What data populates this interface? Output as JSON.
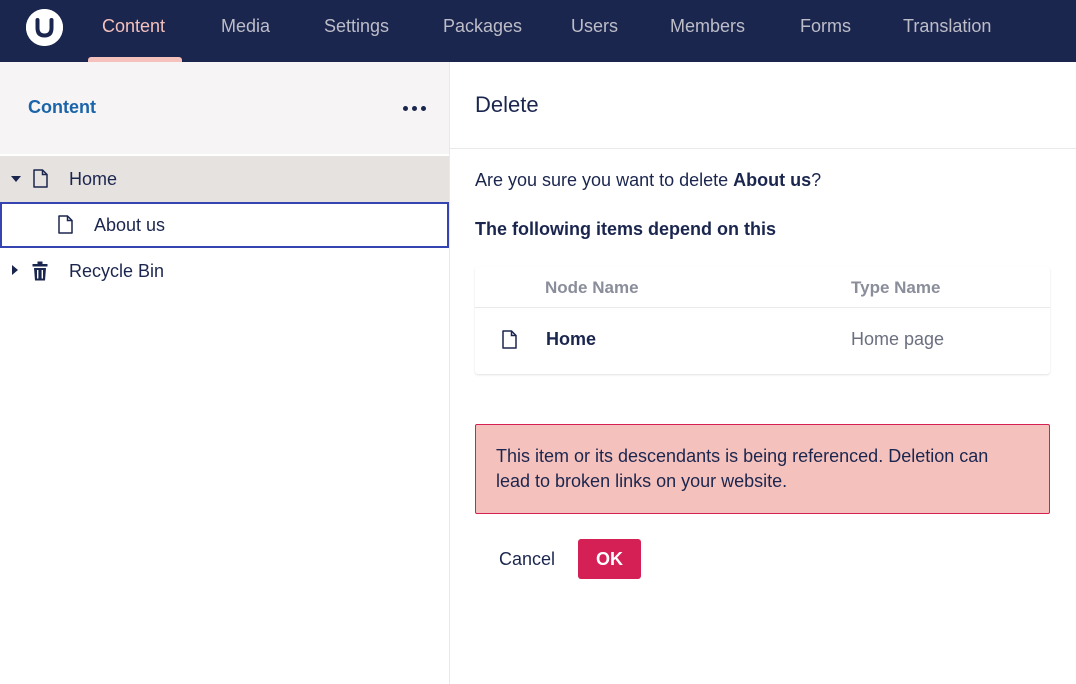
{
  "nav": {
    "items": [
      {
        "label": "Content",
        "active": true
      },
      {
        "label": "Media"
      },
      {
        "label": "Settings"
      },
      {
        "label": "Packages"
      },
      {
        "label": "Users"
      },
      {
        "label": "Members"
      },
      {
        "label": "Forms"
      },
      {
        "label": "Translation"
      }
    ]
  },
  "tree": {
    "title": "Content",
    "items": [
      {
        "label": "Home",
        "icon": "document-icon",
        "expanded": true
      },
      {
        "label": "About us",
        "icon": "document-icon",
        "selected": true
      },
      {
        "label": "Recycle Bin",
        "icon": "trash-icon",
        "expanded": false
      }
    ]
  },
  "dialog": {
    "title": "Delete",
    "confirm_prefix": "Are you sure you want to delete ",
    "confirm_item": "About us",
    "confirm_suffix": "?",
    "depend_heading": "The following items depend on this",
    "table": {
      "columns": [
        "Node Name",
        "Type Name"
      ],
      "rows": [
        {
          "node_name": "Home",
          "type_name": "Home page",
          "icon": "document-icon"
        }
      ]
    },
    "warning": "This item or its descendants is being referenced. Deletion can lead to broken links on your website.",
    "cancel_label": "Cancel",
    "ok_label": "OK"
  },
  "colors": {
    "nav_background": "#1b264f",
    "nav_active": "#f5c1bc",
    "tree_header_title": "#1b64a9",
    "selected_border": "#3544b1",
    "danger": "#d42054",
    "warning_background": "#f5c1bc"
  }
}
